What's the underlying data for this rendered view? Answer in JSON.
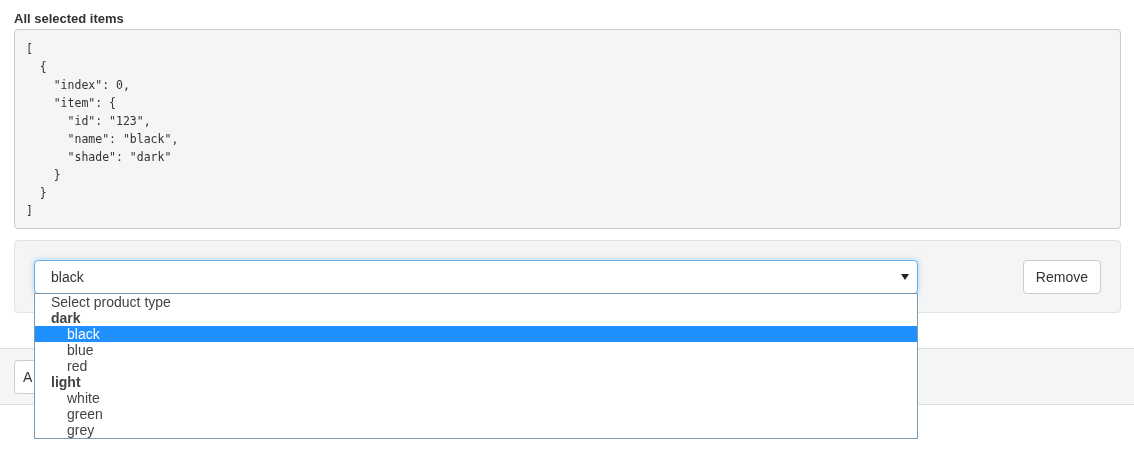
{
  "heading": "All selected items",
  "code_lines": [
    "[",
    "  {",
    "    \"index\": 0,",
    "    \"item\": {",
    "      \"id\": \"123\",",
    "      \"name\": \"black\",",
    "      \"shade\": \"dark\"",
    "    }",
    "  }",
    "]"
  ],
  "select": {
    "value": "black",
    "expanded": true,
    "options": [
      {
        "kind": "placeholder",
        "label": "Select product type",
        "selected": false
      },
      {
        "kind": "group",
        "label": "dark",
        "selected": false
      },
      {
        "kind": "option",
        "label": "black",
        "selected": true
      },
      {
        "kind": "option",
        "label": "blue",
        "selected": false
      },
      {
        "kind": "option",
        "label": "red",
        "selected": false
      },
      {
        "kind": "group",
        "label": "light",
        "selected": false
      },
      {
        "kind": "option",
        "label": "white",
        "selected": false
      },
      {
        "kind": "option",
        "label": "green",
        "selected": false
      },
      {
        "kind": "option",
        "label": "grey",
        "selected": false
      }
    ]
  },
  "remove_button": "Remove",
  "footer_button": "A"
}
